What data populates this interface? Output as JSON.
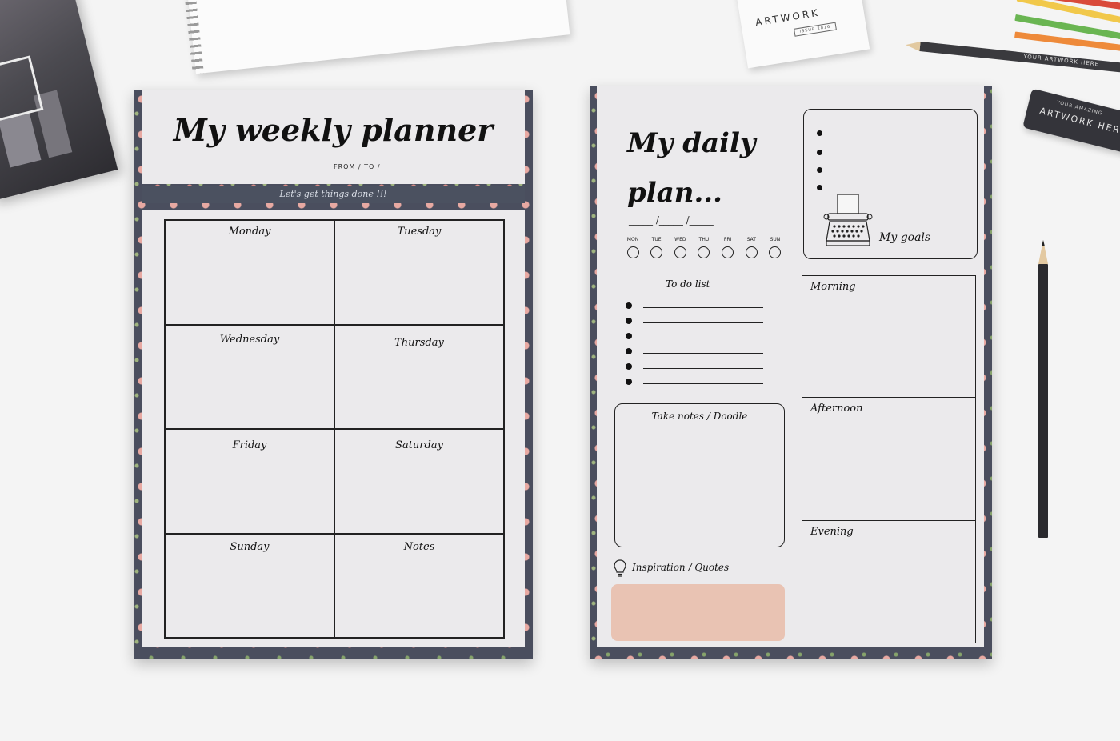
{
  "props": {
    "card_brand": "ARTWORK",
    "card_issue": "ISSUE 2016",
    "pencil_text": "YOUR ARTWORK HERE",
    "eraser_small": "YOUR AMAZING",
    "eraser_big": "ARTWORK HERE"
  },
  "weekly": {
    "title": "My weekly planner",
    "range": "FROM        /            TO        /",
    "tagline": "Let's get things done !!!",
    "cells": [
      "Monday",
      "Tuesday",
      "Wednesday",
      "Thursday",
      "Friday",
      "Saturday",
      "Sunday",
      "Notes"
    ]
  },
  "daily": {
    "title_line1": "My daily",
    "title_line2": "plan...",
    "date_line": "_____ /_____ /_____",
    "days": [
      "MON",
      "TUE",
      "WED",
      "THU",
      "FRI",
      "SAT",
      "SUN"
    ],
    "goals_label": "My goals",
    "todo_title": "To do list",
    "notes_label": "Take notes / Doodle",
    "inspiration_label": "Inspiration / Quotes",
    "slots": [
      "Morning",
      "Afternoon",
      "Evening"
    ]
  },
  "colors": {
    "border_navy": "#4a4e5e",
    "paper": "#ebeaec",
    "quote_pink": "#e9c3b3"
  }
}
